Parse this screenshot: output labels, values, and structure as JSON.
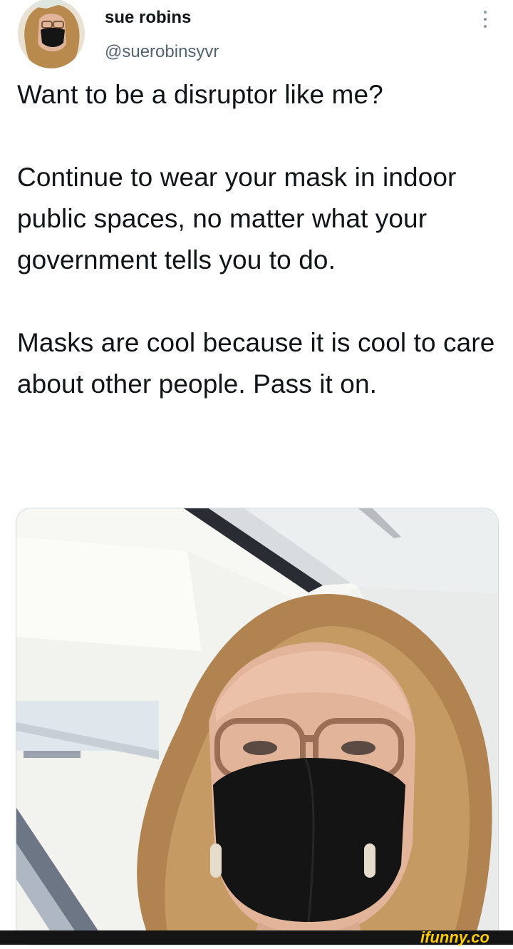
{
  "author": {
    "name": "sue robins",
    "handle": "@suerobinsyvr",
    "avatar_icon": "avatar-photo"
  },
  "more_icon": "more-vertical-icon",
  "tweet": {
    "paragraphs": [
      "Want to be a disruptor like me?",
      "Continue to wear your mask in indoor public spaces, no matter what your government tells you to do.",
      "Masks are cool because it is cool to care about other people. Pass it on."
    ]
  },
  "media": {
    "kind": "photo"
  },
  "watermark": "ifunny.co",
  "colors": {
    "text": "#0f1419",
    "secondary": "#536471",
    "watermark": "#ffcc00"
  }
}
